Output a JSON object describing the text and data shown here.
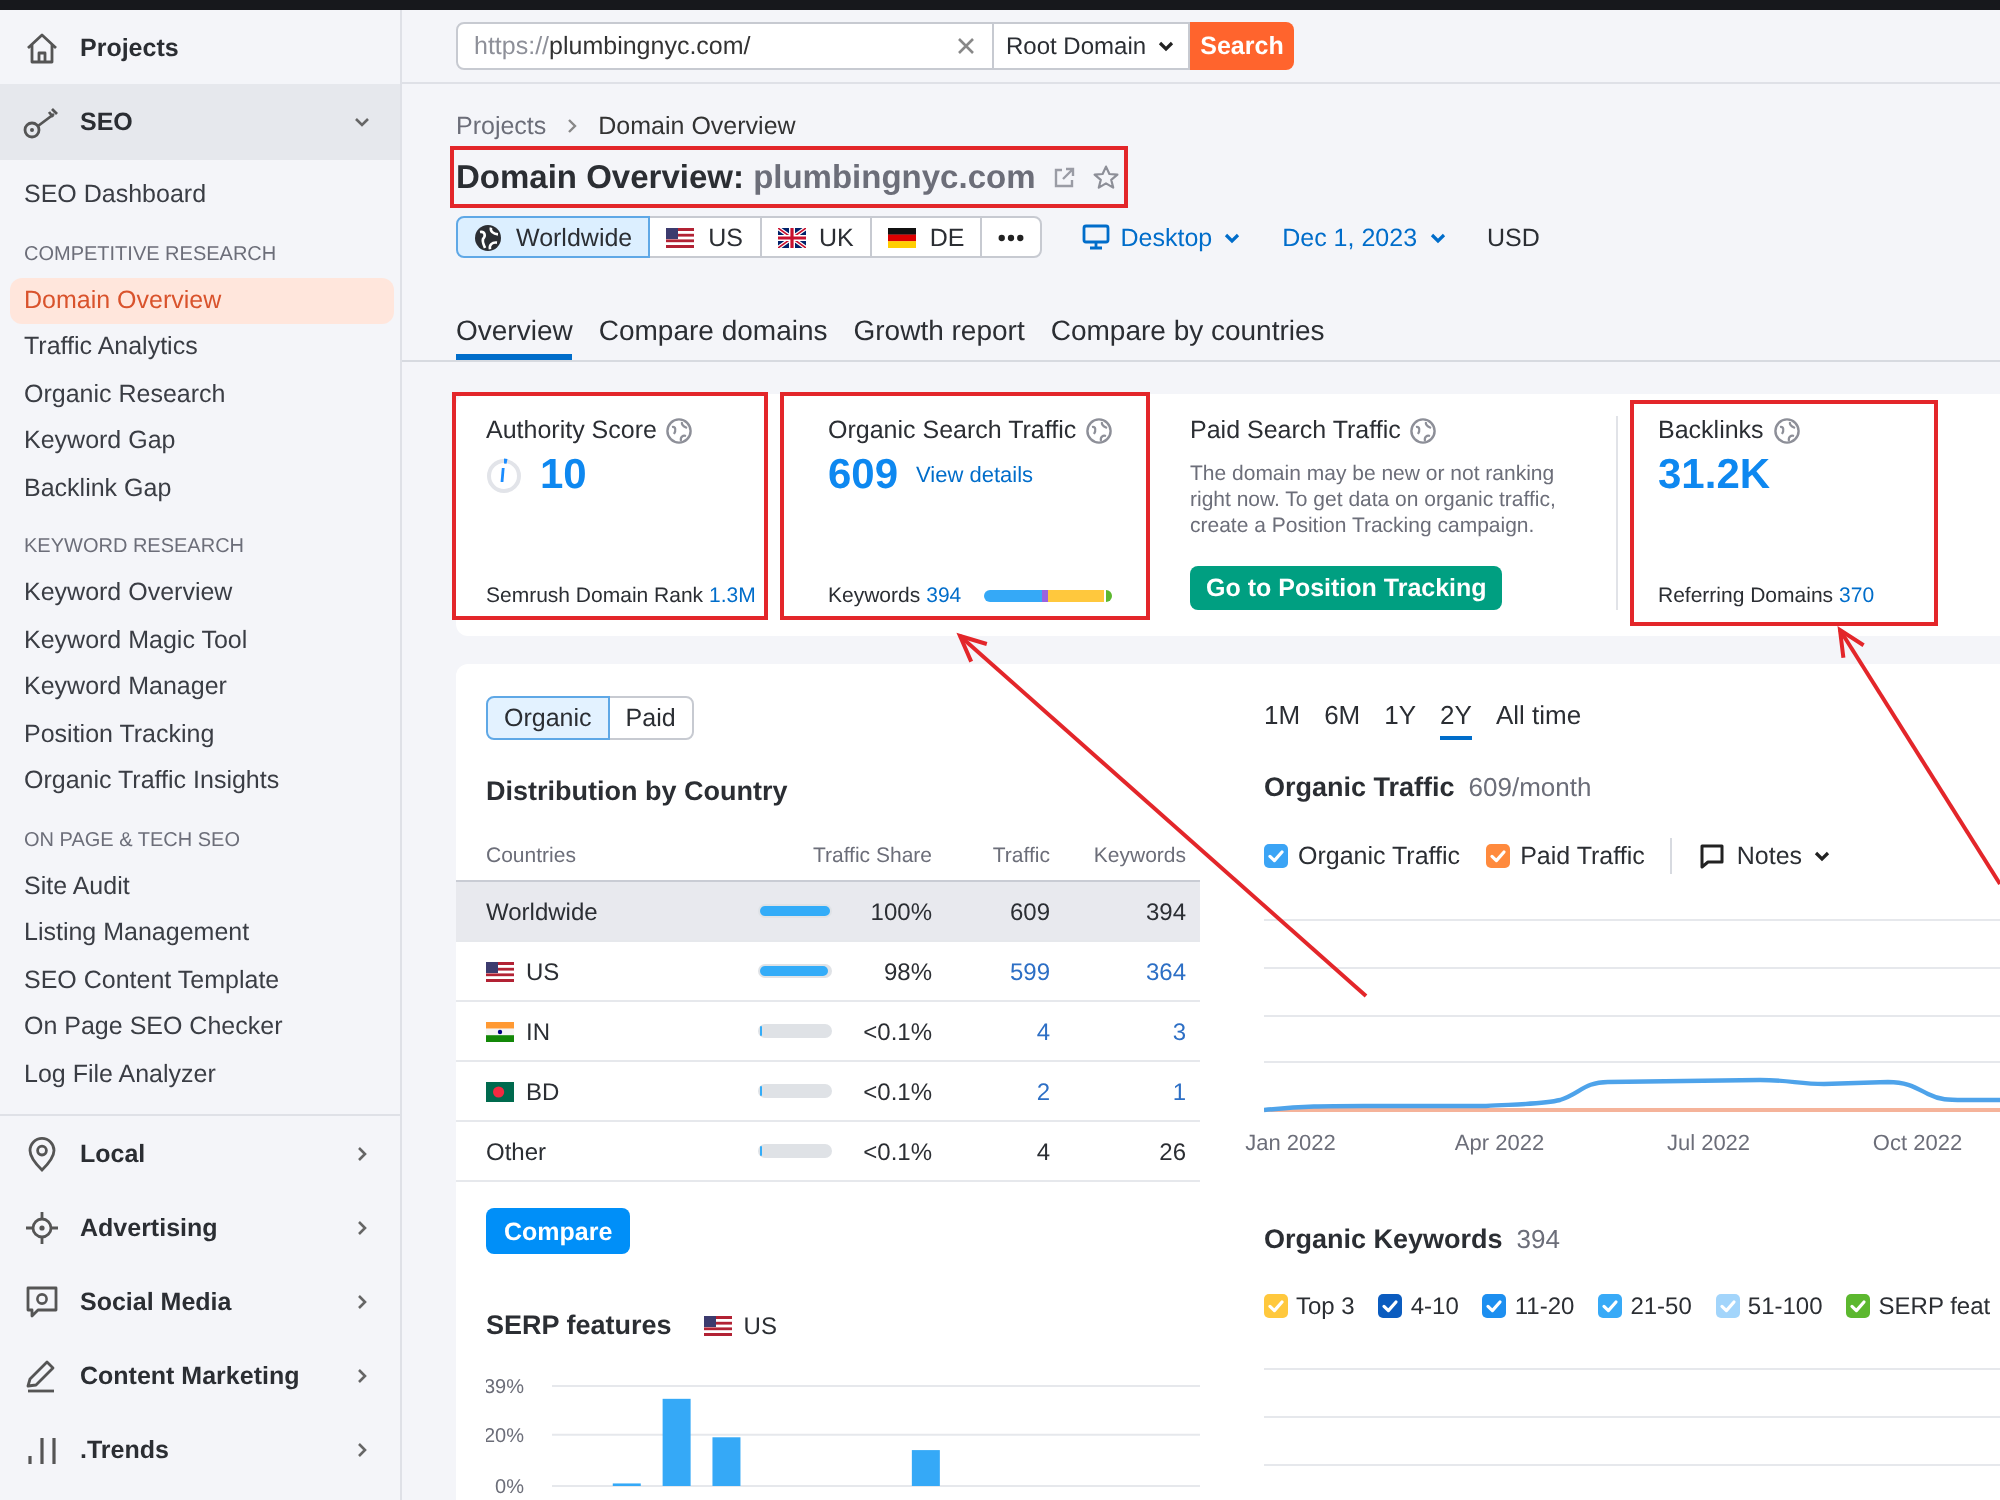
{
  "sidebar": {
    "projects": {
      "label": "Projects"
    },
    "tools": [
      {
        "kind": "key",
        "label": "SEO",
        "expanded": true,
        "groups": [
          {
            "items": [
              {
                "label": "SEO Dashboard",
                "selected": false
              }
            ]
          },
          {
            "heading": "COMPETITIVE RESEARCH",
            "items": [
              {
                "label": "Domain Overview",
                "selected": true
              },
              {
                "label": "Traffic Analytics",
                "selected": false
              },
              {
                "label": "Organic Research",
                "selected": false
              },
              {
                "label": "Keyword Gap",
                "selected": false
              },
              {
                "label": "Backlink Gap",
                "selected": false
              }
            ]
          },
          {
            "heading": "KEYWORD RESEARCH",
            "items": [
              {
                "label": "Keyword Overview",
                "selected": false
              },
              {
                "label": "Keyword Magic Tool",
                "selected": false
              },
              {
                "label": "Keyword Manager",
                "selected": false
              },
              {
                "label": "Position Tracking",
                "selected": false
              },
              {
                "label": "Organic Traffic Insights",
                "selected": false
              }
            ]
          },
          {
            "heading": "ON PAGE & TECH SEO",
            "items": [
              {
                "label": "Site Audit",
                "selected": false
              },
              {
                "label": "Listing Management",
                "selected": false
              },
              {
                "label": "SEO Content Template",
                "selected": false
              },
              {
                "label": "On Page SEO Checker",
                "selected": false
              },
              {
                "label": "Log File Analyzer",
                "selected": false
              }
            ]
          }
        ]
      },
      {
        "kind": "pin",
        "label": "Local",
        "expanded": false
      },
      {
        "kind": "target",
        "label": "Advertising",
        "expanded": false
      },
      {
        "kind": "chat",
        "label": "Social Media",
        "expanded": false
      },
      {
        "kind": "pencil",
        "label": "Content Marketing",
        "expanded": false
      },
      {
        "kind": "bars",
        "label": ".Trends",
        "expanded": false
      }
    ]
  },
  "search": {
    "prefix": "https://",
    "value": "plumbingnyc.com/",
    "scope": "Root Domain",
    "button": "Search"
  },
  "breadcrumbs": [
    "Projects",
    "Domain Overview"
  ],
  "title": {
    "label": "Domain Overview:",
    "domain": "plumbingnyc.com",
    "starred": false,
    "highlighted": true
  },
  "regions": [
    {
      "kind": "globe",
      "label": "Worldwide",
      "selected": true
    },
    {
      "kind": "us",
      "label": "US",
      "selected": false
    },
    {
      "kind": "uk",
      "label": "UK",
      "selected": false
    },
    {
      "kind": "de",
      "label": "DE",
      "selected": false
    },
    {
      "kind": "more",
      "selected": false
    }
  ],
  "device": "Desktop",
  "date": "Dec 1, 2023",
  "currency": "USD",
  "tabs": [
    {
      "label": "Overview",
      "selected": true
    },
    {
      "label": "Compare domains",
      "selected": false
    },
    {
      "label": "Growth report",
      "selected": false
    },
    {
      "label": "Compare by countries",
      "selected": false
    }
  ],
  "metrics": [
    {
      "kind": "authority",
      "title": "Authority Score",
      "value": "10",
      "footer_label": "Semrush Domain Rank",
      "footer_value": "1.3M",
      "highlighted": true,
      "arrow": false
    },
    {
      "kind": "traffic",
      "title": "Organic Search Traffic",
      "value": "609",
      "link": "View details",
      "footer_label": "Keywords",
      "footer_value": "394",
      "highlighted": true,
      "arrow": true
    },
    {
      "kind": "paid",
      "title": "Paid Search Traffic",
      "text": "The domain may be new or not ranking right now. To get data on organic traffic, create a Position Tracking campaign.",
      "button": "Go to Position Tracking",
      "highlighted": false,
      "arrow": false
    },
    {
      "kind": "backlinks",
      "title": "Backlinks",
      "value": "31.2K",
      "footer_label": "Referring Domains",
      "footer_value": "370",
      "highlighted": true,
      "arrow": true
    }
  ],
  "distribution": {
    "toggle": [
      {
        "label": "Organic",
        "selected": true
      },
      {
        "label": "Paid",
        "selected": false
      }
    ],
    "title": "Distribution by Country",
    "columns": [
      "Countries",
      "Traffic Share",
      "Traffic",
      "Keywords"
    ],
    "rows": [
      {
        "kind": "plain",
        "country": "Worldwide",
        "share": "100%",
        "level": 1,
        "traffic": "609",
        "keywords": "394",
        "linked": false,
        "selected": true
      },
      {
        "kind": "us",
        "country": "US",
        "share": "98%",
        "level": 0.98,
        "traffic": "599",
        "keywords": "364",
        "linked": true,
        "selected": false
      },
      {
        "kind": "in",
        "country": "IN",
        "share": "<0.1%",
        "level": 0.01,
        "traffic": "4",
        "keywords": "3",
        "linked": true,
        "selected": false
      },
      {
        "kind": "bd",
        "country": "BD",
        "share": "<0.1%",
        "level": 0.01,
        "traffic": "2",
        "keywords": "1",
        "linked": true,
        "selected": false
      },
      {
        "kind": "plain",
        "country": "Other",
        "share": "<0.1%",
        "level": 0.01,
        "traffic": "4",
        "keywords": "26",
        "linked": false,
        "selected": false
      }
    ],
    "compare_button": "Compare"
  },
  "serp": {
    "title": "SERP features",
    "region": {
      "kind": "us",
      "label": "US"
    },
    "chart_data": {
      "type": "bar",
      "values": [
        null,
        1,
        34,
        19,
        null,
        null,
        null,
        14,
        null,
        null,
        null,
        null,
        null
      ],
      "ylim": [
        0,
        39
      ],
      "yticks": [
        {
          "value": 0,
          "label": "0%"
        },
        {
          "value": 20,
          "label": "20%"
        },
        {
          "value": 39,
          "label": "39%"
        }
      ]
    }
  },
  "periods": [
    {
      "label": "1M",
      "selected": false
    },
    {
      "label": "6M",
      "selected": false
    },
    {
      "label": "1Y",
      "selected": false
    },
    {
      "label": "2Y",
      "selected": true
    },
    {
      "label": "All time",
      "selected": false
    }
  ],
  "traffic": {
    "title": "Organic Traffic",
    "value": "609/month",
    "legend": [
      {
        "label": "Organic Traffic",
        "checked": true,
        "color": "#3ba4f5"
      },
      {
        "label": "Paid Traffic",
        "checked": true,
        "color": "#ff8a3d"
      }
    ],
    "notes": "Notes",
    "x_labels": [
      "Jan 2022",
      "Apr 2022",
      "Jul 2022",
      "Oct 2022"
    ]
  },
  "keywords": {
    "title": "Organic Keywords",
    "value": "394",
    "legend": [
      {
        "label": "Top 3",
        "checked": true,
        "color": "#ffc83d"
      },
      {
        "label": "4-10",
        "checked": true,
        "color": "#0b5cbf"
      },
      {
        "label": "11-20",
        "checked": true,
        "color": "#1d8ff0"
      },
      {
        "label": "21-50",
        "checked": true,
        "color": "#38aaf7"
      },
      {
        "label": "51-100",
        "checked": true,
        "color": "#a3d5fb"
      },
      {
        "label": "SERP feat",
        "checked": true,
        "color": "#5cb82f"
      }
    ]
  }
}
